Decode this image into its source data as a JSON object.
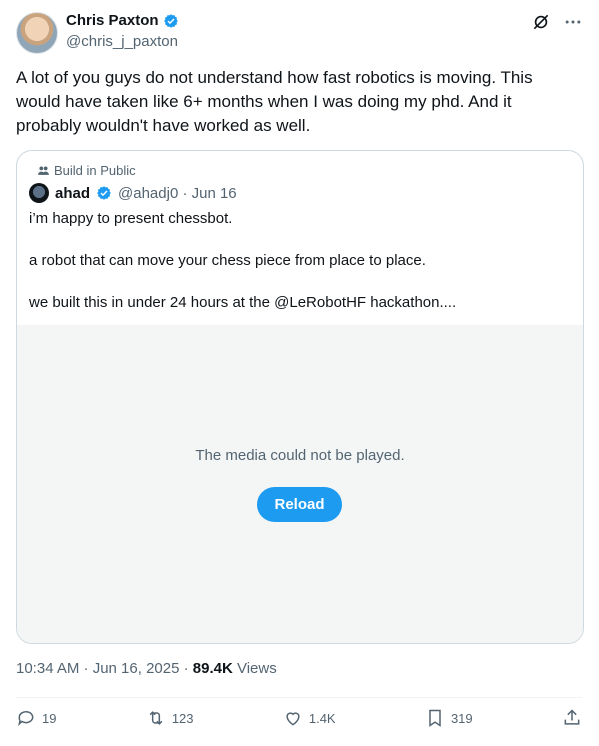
{
  "author": {
    "name": "Chris Paxton",
    "handle": "@chris_j_paxton"
  },
  "tweet": {
    "text": "A lot of you guys do not understand how fast robotics is moving. This would have taken like 6+ months when I was doing my phd. And it probably wouldn't have worked as well."
  },
  "quote": {
    "community": "Build in Public",
    "name": "ahad",
    "handle_date": "@ahadj0 · Jun 16",
    "lines": [
      "i’m happy to present chessbot.",
      "a robot that can move your chess piece from place to place.",
      "we built this in under 24 hours at the @LeRobotHF hackathon...."
    ],
    "media_message": "The media could not be played.",
    "reload_label": "Reload"
  },
  "meta": {
    "time_date": "10:34 AM · Jun 16, 2025 · ",
    "views_count": "89.4K",
    "views_label": " Views"
  },
  "actions": {
    "replies": "19",
    "reposts": "123",
    "likes": "1.4K",
    "bookmarks": "319"
  },
  "colors": {
    "accent": "#1d9bf0",
    "text": "#0f1419",
    "muted": "#536471"
  }
}
